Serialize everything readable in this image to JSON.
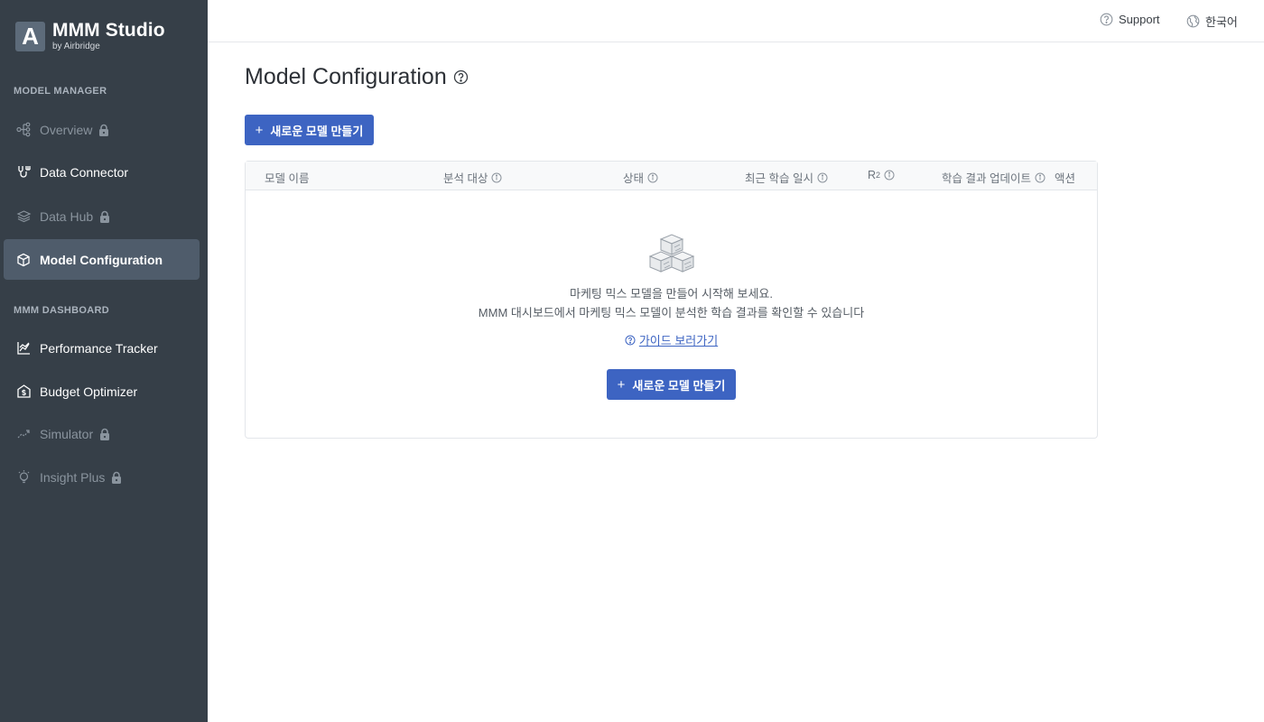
{
  "brand": {
    "logo_letter": "A",
    "name": "MMM Studio",
    "sub": "by Airbridge"
  },
  "sidebar": {
    "sections": [
      {
        "label": "MODEL MANAGER"
      },
      {
        "label": "MMM DASHBOARD"
      }
    ],
    "items": [
      {
        "label": "Overview",
        "icon": "hierarchy-icon",
        "locked": true,
        "state": "disabled"
      },
      {
        "label": "Data Connector",
        "icon": "connector-icon",
        "locked": false,
        "state": "enabled"
      },
      {
        "label": "Data Hub",
        "icon": "layers-icon",
        "locked": true,
        "state": "disabled"
      },
      {
        "label": "Model Configuration",
        "icon": "cube-icon",
        "locked": false,
        "state": "active"
      },
      {
        "label": "Performance Tracker",
        "icon": "line-chart-icon",
        "locked": false,
        "state": "enabled"
      },
      {
        "label": "Budget Optimizer",
        "icon": "budget-icon",
        "locked": false,
        "state": "enabled"
      },
      {
        "label": "Simulator",
        "icon": "trend-icon",
        "locked": true,
        "state": "disabled"
      },
      {
        "label": "Insight Plus",
        "icon": "lightbulb-icon",
        "locked": true,
        "state": "disabled"
      }
    ]
  },
  "topbar": {
    "support": "Support",
    "language": "한국어"
  },
  "page": {
    "title": "Model Configuration"
  },
  "actions": {
    "new_model": "새로운 모델 만들기",
    "plus": "+"
  },
  "table": {
    "columns": [
      {
        "label": "모델 이름",
        "info": false
      },
      {
        "label": "분석 대상",
        "info": true
      },
      {
        "label": "상태",
        "info": true
      },
      {
        "label": "최근 학습 일시",
        "info": true
      },
      {
        "label": "R",
        "sup": "2",
        "info": true
      },
      {
        "label": "학습 결과 업데이트",
        "info": true
      },
      {
        "label": "액션",
        "info": false
      }
    ]
  },
  "empty": {
    "line1": "마케팅 믹스 모델을 만들어 시작해 보세요.",
    "line2": "MMM 대시보드에서 마케팅 믹스 모델이 분석한 학습 결과를 확인할 수 있습니다",
    "guide": "가이드 보러가기"
  },
  "colors": {
    "sidebar_bg": "#363f48",
    "active_bg": "#4f5c6b",
    "primary": "#3d64c2"
  }
}
